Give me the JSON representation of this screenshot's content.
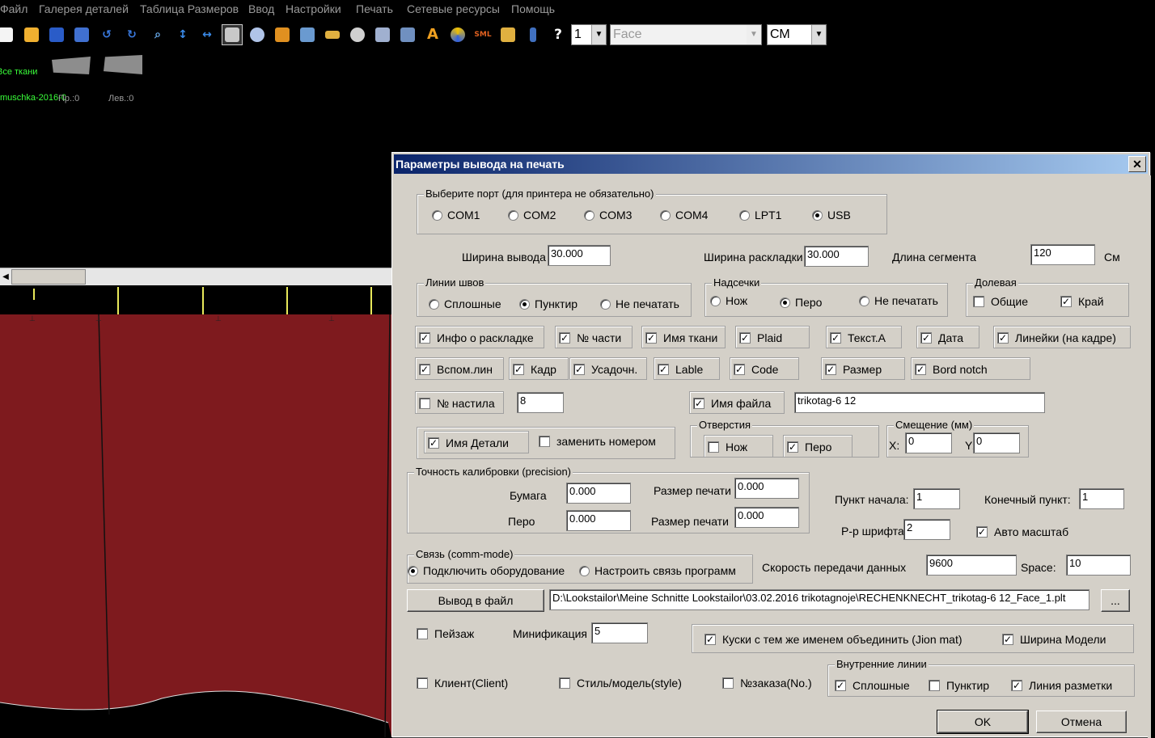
{
  "menu": [
    "Файл",
    "Галерея деталей",
    "Таблица Размеров",
    "Ввод",
    "Настройки",
    "Печать",
    "Сетевые ресурсы",
    "Помощь"
  ],
  "toolbar": {
    "icons": [
      "new-file-icon",
      "open-folder-icon",
      "save-icon",
      "save-as-icon",
      "undo-icon",
      "redo-icon",
      "zoom-icon",
      "vertical-arrows-icon",
      "horizontal-arrows-icon",
      "print-layout-icon",
      "film-icon",
      "pattern-icon",
      "export-icon",
      "ruler-icon",
      "spool-icon",
      "eraser-icon",
      "connect-icon",
      "text-icon",
      "color-wheel-icon",
      "sml-icon",
      "table-icon",
      "figure-icon",
      "help-icon"
    ],
    "page_value": "1",
    "face_value": "Face",
    "unit_value": "СМ",
    "sml_label": "SML",
    "text_glyph": "A",
    "help_glyph": "?"
  },
  "workspace": {
    "all_fabrics": "Все ткани",
    "file_label": "muschka-2016-0",
    "right_count": "Пр.:0",
    "left_count": "Лев.:0"
  },
  "dialog": {
    "title": "Параметры вывода на печать",
    "close_glyph": "✕",
    "port_group": "Выберите порт (для принтера не обязательно)",
    "ports": [
      "COM1",
      "COM2",
      "COM3",
      "COM4",
      "LPT1",
      "USB"
    ],
    "selected_port": "USB",
    "output_width_label": "Ширина вывода",
    "output_width": "30.000",
    "layout_width_label": "Ширина раскладки",
    "layout_width": "30.000",
    "segment_length_label": "Длина сегмента",
    "segment_length": "120",
    "unit": "См",
    "seam_group": "Линии швов",
    "seam_options": [
      "Сплошные",
      "Пунктир",
      "Не печатать"
    ],
    "notch_group": "Надсечки",
    "notch_options": [
      "Нож",
      "Перо",
      "Не печатать"
    ],
    "grain_group": "Долевая",
    "grain_general": "Общие",
    "grain_edge": "Край",
    "row1": [
      "Инфо о раскладке",
      "№ части",
      "Имя ткани",
      "Plaid",
      "Текст.А",
      "Дата",
      "Линейки (на кадре)"
    ],
    "row2": [
      "Вспом.лин",
      "Кадр",
      "Усадочн.",
      "Lable",
      "Code",
      "Размер",
      "Bord notch"
    ],
    "ply_number_label": "№ настила",
    "ply_number": "8",
    "file_name_label": "Имя файла",
    "file_name": "trikotag-6 12",
    "detail_name_label": "Имя Детали",
    "replace_number_label": "заменить номером",
    "holes_group": "Отверстия",
    "holes_knife": "Нож",
    "holes_pen": "Перо",
    "offset_group": "Смещение (мм)",
    "offset_x_label": "X:",
    "offset_x": "0",
    "offset_y_label": "Y:",
    "offset_y": "0",
    "precision_group": "Точность калибровки (precision)",
    "paper_label": "Бумага",
    "paper_value": "0.000",
    "pen_label": "Перо",
    "pen_value": "0.000",
    "print_size_label_1": "Размер печати",
    "print_size_1": "0.000",
    "print_size_label_2": "Размер печати",
    "print_size_2": "0.000",
    "start_point_label": "Пункт начала:",
    "start_point": "1",
    "end_point_label": "Конечный пункт:",
    "end_point": "1",
    "font_size_label": "Р-р шрифта",
    "font_size": "2",
    "auto_scale_label": "Авто масштаб",
    "comm_group": "Связь (comm-mode)",
    "comm_connect": "Подключить оборудование",
    "comm_setup": "Настроить связь программ",
    "baud_label": "Скорость передачи данных",
    "baud_value": "9600",
    "space_label": "Space:",
    "space_value": "10",
    "output_file_button": "Вывод в файл",
    "output_path": "D:\\Lookstailor\\Meine Schnitte Lookstailor\\03.02.2016 trikotagnoje\\RECHENKNECHT_trikotag-6 12_Face_1.plt",
    "browse_button": "...",
    "landscape_label": "Пейзаж",
    "minification_label": "Минификация",
    "minification_value": "5",
    "join_label": "Куски с тем же именем объединить (Jion mat)",
    "model_width_label": "Ширина Модели",
    "client_label": "Клиент(Client)",
    "style_label": "Стиль/модель(style)",
    "order_label": "№заказа(No.)",
    "inner_lines_group": "Внутренние линии",
    "inner_solid": "Сплошные",
    "inner_dashed": "Пунктир",
    "inner_marking": "Линия разметки",
    "ok_button": "OK",
    "cancel_button": "Отмена"
  }
}
